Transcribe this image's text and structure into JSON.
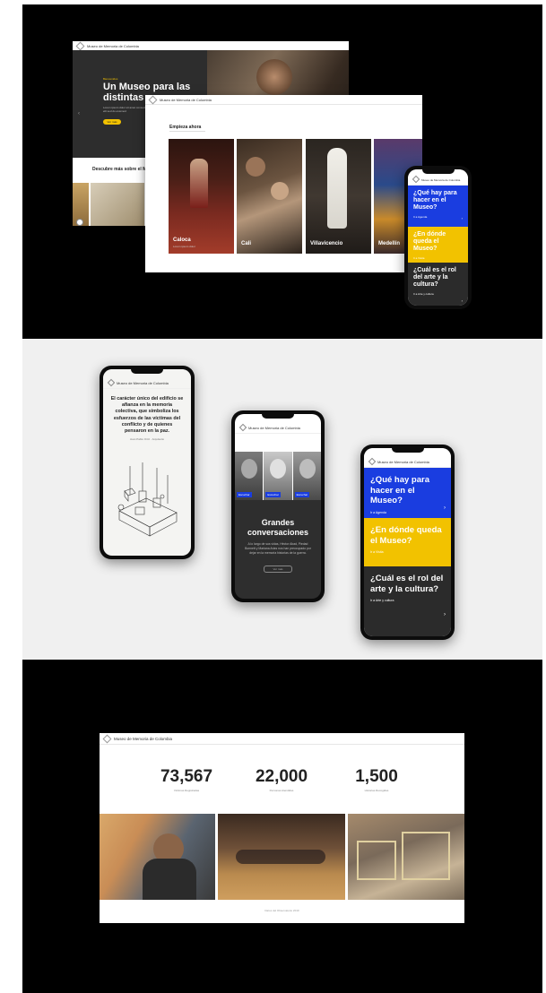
{
  "brand": {
    "title": "Museo de Memoria de Colombia"
  },
  "hero": {
    "eyebrow": "Bienvenidos",
    "title": "Un Museo para las distintas g",
    "text": "Lorem ipsum dolor sit amet consectetur adipiscing elit sed do eiusmod",
    "cta": "Ver más"
  },
  "discover": {
    "title": "Descubre más sobre el M"
  },
  "regions": {
    "title": "Empieza ahora",
    "cards": [
      {
        "label": "Caloca",
        "sub": "Lorem ipsum dolor"
      },
      {
        "label": "Cali",
        "sub": ""
      },
      {
        "label": "Villavicencio",
        "sub": ""
      },
      {
        "label": "Medellín",
        "sub": ""
      }
    ]
  },
  "questions": [
    {
      "title": "¿Qué hay para hacer en el Museo?",
      "sub": "Ir a Agenda",
      "color": "#1a3de0"
    },
    {
      "title": "¿En dónde queda el Museo?",
      "sub": "Ir a Visita",
      "color": "#f2c200"
    },
    {
      "title": "¿Cuál es el rol del arte y la cultura?",
      "sub": "Ir a Arte y cultura",
      "color": "#2b2b2b"
    }
  ],
  "quote_phone": {
    "quote": "El carácter único del edificio se afianza en la memoria colectiva, que simboliza los esfuerzos de las víctimas del conflicto y de quienes pensaron en la paz.",
    "author": "Juan Pablo Ortiz · Arquitecto"
  },
  "conversations": {
    "title": "Grandes conversaciones",
    "text": "A lo largo de sus vidas, Héctor Abad, Piedad Bonnett y Mariana Arias nos han preocupado por dejar en la memoria historias de la guerra.",
    "people": [
      "Escuchar",
      "Escuchar",
      "Escuchar"
    ],
    "button": "Ver más"
  },
  "stats": [
    {
      "value": "73,567",
      "label": "Víctimas Registradas"
    },
    {
      "value": "22,000",
      "label": "Personas Atendidas"
    },
    {
      "value": "1,500",
      "label": "Historias Recogidas"
    }
  ],
  "footnote": "Datos del Observatorio 2019",
  "icons": {
    "arrow": "arrow-right-icon",
    "logo": "museum-logo-icon"
  }
}
